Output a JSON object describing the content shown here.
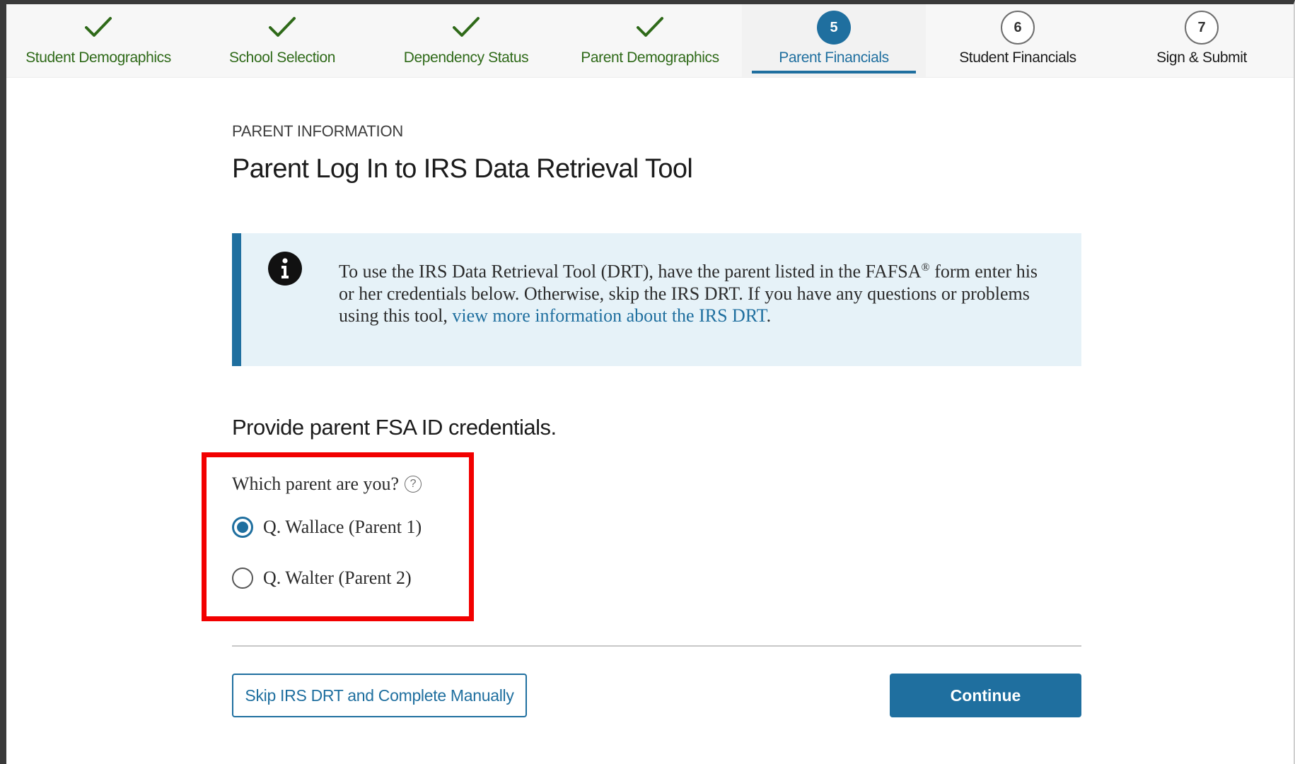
{
  "colors": {
    "primary": "#1f6f9f",
    "done": "#2f6a19",
    "alert_bg": "#e6f2f8",
    "highlight": "#f20000"
  },
  "steps": [
    {
      "label": "Student Demographics",
      "status": "done",
      "icon": "check-icon"
    },
    {
      "label": "School Selection",
      "status": "done",
      "icon": "check-icon"
    },
    {
      "label": "Dependency Status",
      "status": "done",
      "icon": "check-icon"
    },
    {
      "label": "Parent Demographics",
      "status": "done",
      "icon": "check-icon"
    },
    {
      "label": "Parent Financials",
      "status": "current",
      "number": "5"
    },
    {
      "label": "Student Financials",
      "status": "todo",
      "number": "6"
    },
    {
      "label": "Sign & Submit",
      "status": "todo",
      "number": "7"
    }
  ],
  "page": {
    "kicker": "PARENT INFORMATION",
    "title": "Parent Log In to IRS Data Retrieval Tool"
  },
  "alert": {
    "icon": "info-icon",
    "text_before": "To use the IRS Data Retrieval Tool (DRT), have the parent listed in the FAFSA",
    "registered": "®",
    "text_after": " form enter his or her credentials below. Otherwise, skip the IRS DRT. If you have any questions or problems using this tool, ",
    "link_text": "view more information about the IRS DRT",
    "text_end": "."
  },
  "form": {
    "subheading": "Provide parent FSA ID credentials.",
    "question": "Which parent are you?",
    "help_icon": "question-icon",
    "help_glyph": "?",
    "options": [
      {
        "label": "Q. Wallace (Parent 1)",
        "checked": true
      },
      {
        "label": "Q. Walter (Parent 2)",
        "checked": false
      }
    ]
  },
  "buttons": {
    "skip": "Skip IRS DRT and Complete Manually",
    "continue": "Continue"
  }
}
